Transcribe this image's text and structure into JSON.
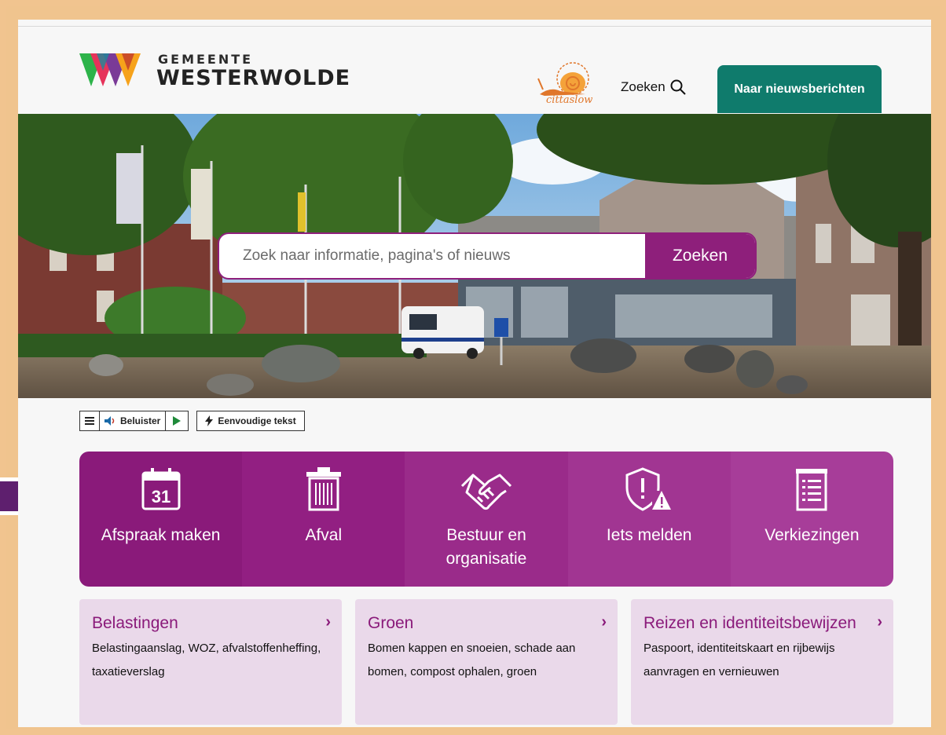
{
  "header": {
    "logo_line1": "GEMEENTE",
    "logo_line2": "WESTERWOLDE",
    "cittaslow_label": "cittaslow",
    "search_label": "Zoeken",
    "news_button": "Naar nieuwsberichten"
  },
  "hero": {
    "search_placeholder": "Zoek naar informatie, pagina's of nieuws",
    "search_button": "Zoeken"
  },
  "readspeaker": {
    "listen_label": "Beluister",
    "simple_text_label": "Eenvoudige tekst"
  },
  "tiles": [
    {
      "label": "Afspraak maken",
      "icon": "calendar-icon",
      "day": "31"
    },
    {
      "label": "Afval",
      "icon": "trash-bin-icon"
    },
    {
      "label": "Bestuur en organisatie",
      "icon": "handshake-icon"
    },
    {
      "label": "Iets melden",
      "icon": "shield-warning-icon"
    },
    {
      "label": "Verkiezingen",
      "icon": "ballot-list-icon"
    }
  ],
  "cards": [
    {
      "title": "Belastingen",
      "text": "Belastingaanslag, WOZ, afvalstoffenheffing, taxatieverslag"
    },
    {
      "title": "Groen",
      "text": "Bomen kappen en snoeien, schade aan bomen, compost ophalen, groen"
    },
    {
      "title": "Reizen en identiteitsbewijzen",
      "text": "Paspoort, identiteitskaart en rijbewijs aanvragen en vernieuwen"
    }
  ],
  "colors": {
    "frame": "#f0c48e",
    "brand_purple": "#8a1a7a",
    "news_green": "#0f7b6c",
    "card_bg": "#ead9ea",
    "pointer_arrow": "#5e1f6e"
  }
}
